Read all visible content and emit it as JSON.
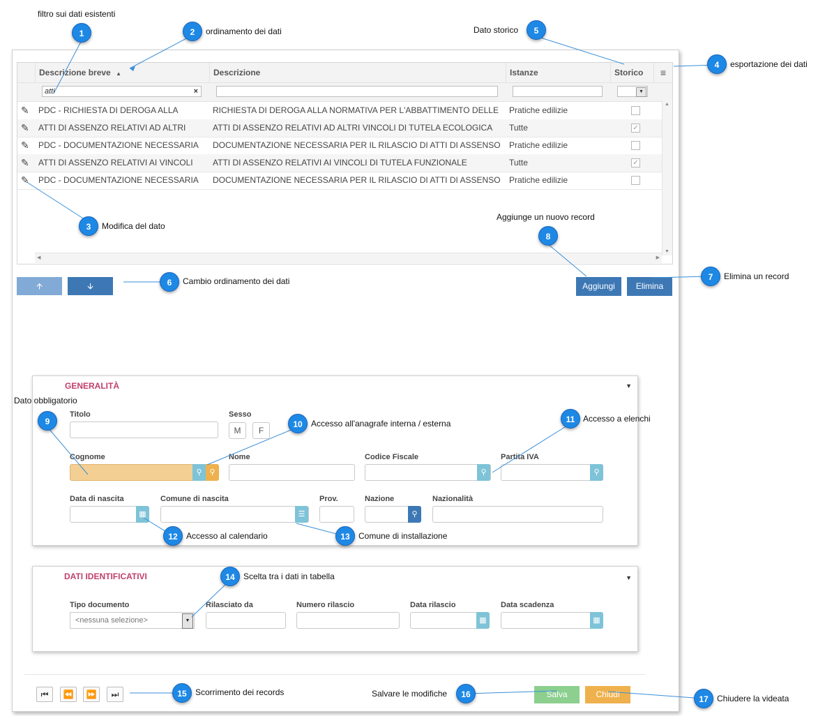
{
  "grid": {
    "columns": [
      "Descrizione breve",
      "Descrizione",
      "Istanze",
      "Storico"
    ],
    "filter_value": "atti",
    "rows": [
      {
        "short": "PDC - RICHIESTA DI DEROGA ALLA",
        "desc": "RICHIESTA DI DEROGA ALLA NORMATIVA PER L'ABBATTIMENTO DELLE",
        "ist": "Pratiche edilizie",
        "storico": false
      },
      {
        "short": "ATTI DI ASSENZO RELATIVI AD ALTRI",
        "desc": "ATTI DI ASSENZO RELATIVI AD ALTRI VINCOLI DI TUTELA ECOLOGICA",
        "ist": "Tutte",
        "storico": true
      },
      {
        "short": "PDC - DOCUMENTAZIONE NECESSARIA",
        "desc": "DOCUMENTAZIONE NECESSARIA PER IL RILASCIO DI ATTI DI ASSENSO",
        "ist": "Pratiche edilizie",
        "storico": false
      },
      {
        "short": "ATTI DI ASSENZO RELATIVI AI VINCOLI",
        "desc": "ATTI DI ASSENZO RELATIVI AI VINCOLI DI TUTELA FUNZIONALE",
        "ist": "Tutte",
        "storico": true
      },
      {
        "short": "PDC - DOCUMENTAZIONE NECESSARIA",
        "desc": "DOCUMENTAZIONE NECESSARIA PER IL RILASCIO DI ATTI DI ASSENSO",
        "ist": "Pratiche edilizie",
        "storico": false
      }
    ]
  },
  "buttons": {
    "add": "Aggiungi",
    "delete": "Elimina",
    "save": "Salva",
    "close": "Chiudi"
  },
  "generalita": {
    "title": "GENERALITÀ",
    "labels": {
      "titolo": "Titolo",
      "sesso": "Sesso",
      "cognome": "Cognome",
      "nome": "Nome",
      "cf": "Codice Fiscale",
      "piva": "Partita IVA",
      "data_nascita": "Data di nascita",
      "comune_nascita": "Comune di nascita",
      "prov": "Prov.",
      "nazione": "Nazione",
      "nazionalita": "Nazionalità"
    },
    "sex_m": "M",
    "sex_f": "F"
  },
  "identificativi": {
    "title": "DATI IDENTIFICATIVI",
    "labels": {
      "tipo": "Tipo documento",
      "rilasciato": "Rilasciato da",
      "numero": "Numero rilascio",
      "data_ril": "Data rilascio",
      "scadenza": "Data scadenza"
    },
    "tipo_value": "<nessuna selezione>"
  },
  "annotations": {
    "n1": "filtro sui dati esistenti",
    "n2": "ordinamento dei dati",
    "n3": "Modifica del dato",
    "n4": "esportazione dei dati",
    "n5": "Dato storico",
    "n6": "Cambio ordinamento dei dati",
    "n7": "Elimina un record",
    "n8": "Aggiunge un nuovo record",
    "n9": "Dato obbligatorio",
    "n10": "Accesso all'anagrafe interna / esterna",
    "n11": "Accesso a elenchi",
    "n12": "Accesso al calendario",
    "n13": "Comune di installazione",
    "n14": "Scelta tra i dati in tabella",
    "n15": "Scorrimento dei records",
    "n16": "Salvare le modifiche",
    "n17": "Chiudere la videata"
  },
  "callout_numbers": [
    "1",
    "2",
    "3",
    "4",
    "5",
    "6",
    "7",
    "8",
    "9",
    "10",
    "11",
    "12",
    "13",
    "14",
    "15",
    "16",
    "17"
  ],
  "colors": {
    "callout": "#1e88e5",
    "button_blue": "#3d78b5",
    "save_green": "#8ccf8f",
    "close_orange": "#efb14d",
    "required_field": "#f3cf94",
    "section_title": "#c0406a"
  }
}
